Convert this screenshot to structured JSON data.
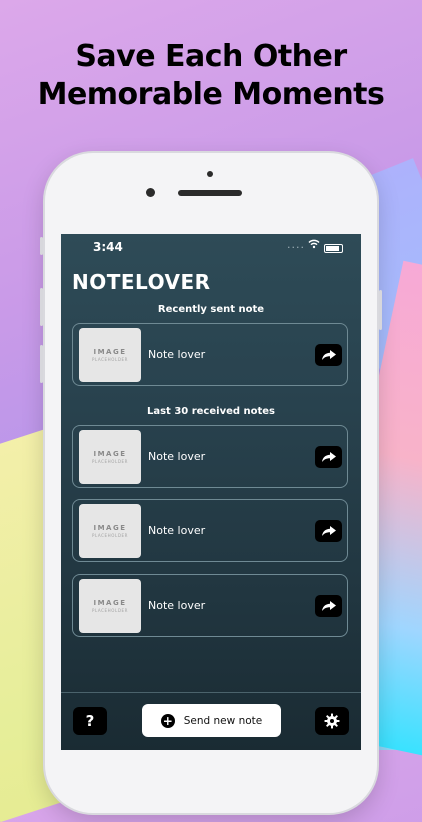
{
  "promo": {
    "headline_line1": "Save Each Other",
    "headline_line2": "Memorable Moments"
  },
  "status_bar": {
    "time": "3:44",
    "signal": "....",
    "wifi_icon": "wifi-icon",
    "battery_icon": "battery-icon"
  },
  "app": {
    "title": "NOTELOVER"
  },
  "sections": {
    "recent_title": "Recently sent note",
    "received_title": "Last 30 received notes"
  },
  "recent_note": {
    "image_line1": "IMAGE",
    "image_line2": "PLACEHOLDER",
    "label": "Note lover"
  },
  "received_notes": [
    {
      "image_line1": "IMAGE",
      "image_line2": "PLACEHOLDER",
      "label": "Note lover"
    },
    {
      "image_line1": "IMAGE",
      "image_line2": "PLACEHOLDER",
      "label": "Note lover"
    },
    {
      "image_line1": "IMAGE",
      "image_line2": "PLACEHOLDER",
      "label": "Note lover"
    }
  ],
  "bottom_bar": {
    "help_label": "?",
    "send_label": "Send new note",
    "send_icon": "plus-circle-icon",
    "settings_icon": "gear-icon"
  },
  "colors": {
    "screen_bg_top": "#2e4b57",
    "screen_bg_bottom": "#1a2b33",
    "card_border": "#6f8a94",
    "button_black": "#000000"
  }
}
